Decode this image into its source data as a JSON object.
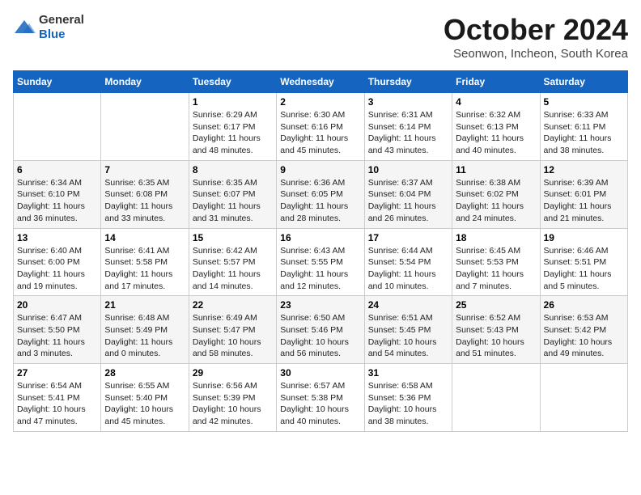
{
  "header": {
    "logo_general": "General",
    "logo_blue": "Blue",
    "month": "October 2024",
    "location": "Seonwon, Incheon, South Korea"
  },
  "days_of_week": [
    "Sunday",
    "Monday",
    "Tuesday",
    "Wednesday",
    "Thursday",
    "Friday",
    "Saturday"
  ],
  "weeks": [
    [
      {
        "num": "",
        "sunrise": "",
        "sunset": "",
        "daylight": ""
      },
      {
        "num": "",
        "sunrise": "",
        "sunset": "",
        "daylight": ""
      },
      {
        "num": "1",
        "sunrise": "Sunrise: 6:29 AM",
        "sunset": "Sunset: 6:17 PM",
        "daylight": "Daylight: 11 hours and 48 minutes."
      },
      {
        "num": "2",
        "sunrise": "Sunrise: 6:30 AM",
        "sunset": "Sunset: 6:16 PM",
        "daylight": "Daylight: 11 hours and 45 minutes."
      },
      {
        "num": "3",
        "sunrise": "Sunrise: 6:31 AM",
        "sunset": "Sunset: 6:14 PM",
        "daylight": "Daylight: 11 hours and 43 minutes."
      },
      {
        "num": "4",
        "sunrise": "Sunrise: 6:32 AM",
        "sunset": "Sunset: 6:13 PM",
        "daylight": "Daylight: 11 hours and 40 minutes."
      },
      {
        "num": "5",
        "sunrise": "Sunrise: 6:33 AM",
        "sunset": "Sunset: 6:11 PM",
        "daylight": "Daylight: 11 hours and 38 minutes."
      }
    ],
    [
      {
        "num": "6",
        "sunrise": "Sunrise: 6:34 AM",
        "sunset": "Sunset: 6:10 PM",
        "daylight": "Daylight: 11 hours and 36 minutes."
      },
      {
        "num": "7",
        "sunrise": "Sunrise: 6:35 AM",
        "sunset": "Sunset: 6:08 PM",
        "daylight": "Daylight: 11 hours and 33 minutes."
      },
      {
        "num": "8",
        "sunrise": "Sunrise: 6:35 AM",
        "sunset": "Sunset: 6:07 PM",
        "daylight": "Daylight: 11 hours and 31 minutes."
      },
      {
        "num": "9",
        "sunrise": "Sunrise: 6:36 AM",
        "sunset": "Sunset: 6:05 PM",
        "daylight": "Daylight: 11 hours and 28 minutes."
      },
      {
        "num": "10",
        "sunrise": "Sunrise: 6:37 AM",
        "sunset": "Sunset: 6:04 PM",
        "daylight": "Daylight: 11 hours and 26 minutes."
      },
      {
        "num": "11",
        "sunrise": "Sunrise: 6:38 AM",
        "sunset": "Sunset: 6:02 PM",
        "daylight": "Daylight: 11 hours and 24 minutes."
      },
      {
        "num": "12",
        "sunrise": "Sunrise: 6:39 AM",
        "sunset": "Sunset: 6:01 PM",
        "daylight": "Daylight: 11 hours and 21 minutes."
      }
    ],
    [
      {
        "num": "13",
        "sunrise": "Sunrise: 6:40 AM",
        "sunset": "Sunset: 6:00 PM",
        "daylight": "Daylight: 11 hours and 19 minutes."
      },
      {
        "num": "14",
        "sunrise": "Sunrise: 6:41 AM",
        "sunset": "Sunset: 5:58 PM",
        "daylight": "Daylight: 11 hours and 17 minutes."
      },
      {
        "num": "15",
        "sunrise": "Sunrise: 6:42 AM",
        "sunset": "Sunset: 5:57 PM",
        "daylight": "Daylight: 11 hours and 14 minutes."
      },
      {
        "num": "16",
        "sunrise": "Sunrise: 6:43 AM",
        "sunset": "Sunset: 5:55 PM",
        "daylight": "Daylight: 11 hours and 12 minutes."
      },
      {
        "num": "17",
        "sunrise": "Sunrise: 6:44 AM",
        "sunset": "Sunset: 5:54 PM",
        "daylight": "Daylight: 11 hours and 10 minutes."
      },
      {
        "num": "18",
        "sunrise": "Sunrise: 6:45 AM",
        "sunset": "Sunset: 5:53 PM",
        "daylight": "Daylight: 11 hours and 7 minutes."
      },
      {
        "num": "19",
        "sunrise": "Sunrise: 6:46 AM",
        "sunset": "Sunset: 5:51 PM",
        "daylight": "Daylight: 11 hours and 5 minutes."
      }
    ],
    [
      {
        "num": "20",
        "sunrise": "Sunrise: 6:47 AM",
        "sunset": "Sunset: 5:50 PM",
        "daylight": "Daylight: 11 hours and 3 minutes."
      },
      {
        "num": "21",
        "sunrise": "Sunrise: 6:48 AM",
        "sunset": "Sunset: 5:49 PM",
        "daylight": "Daylight: 11 hours and 0 minutes."
      },
      {
        "num": "22",
        "sunrise": "Sunrise: 6:49 AM",
        "sunset": "Sunset: 5:47 PM",
        "daylight": "Daylight: 10 hours and 58 minutes."
      },
      {
        "num": "23",
        "sunrise": "Sunrise: 6:50 AM",
        "sunset": "Sunset: 5:46 PM",
        "daylight": "Daylight: 10 hours and 56 minutes."
      },
      {
        "num": "24",
        "sunrise": "Sunrise: 6:51 AM",
        "sunset": "Sunset: 5:45 PM",
        "daylight": "Daylight: 10 hours and 54 minutes."
      },
      {
        "num": "25",
        "sunrise": "Sunrise: 6:52 AM",
        "sunset": "Sunset: 5:43 PM",
        "daylight": "Daylight: 10 hours and 51 minutes."
      },
      {
        "num": "26",
        "sunrise": "Sunrise: 6:53 AM",
        "sunset": "Sunset: 5:42 PM",
        "daylight": "Daylight: 10 hours and 49 minutes."
      }
    ],
    [
      {
        "num": "27",
        "sunrise": "Sunrise: 6:54 AM",
        "sunset": "Sunset: 5:41 PM",
        "daylight": "Daylight: 10 hours and 47 minutes."
      },
      {
        "num": "28",
        "sunrise": "Sunrise: 6:55 AM",
        "sunset": "Sunset: 5:40 PM",
        "daylight": "Daylight: 10 hours and 45 minutes."
      },
      {
        "num": "29",
        "sunrise": "Sunrise: 6:56 AM",
        "sunset": "Sunset: 5:39 PM",
        "daylight": "Daylight: 10 hours and 42 minutes."
      },
      {
        "num": "30",
        "sunrise": "Sunrise: 6:57 AM",
        "sunset": "Sunset: 5:38 PM",
        "daylight": "Daylight: 10 hours and 40 minutes."
      },
      {
        "num": "31",
        "sunrise": "Sunrise: 6:58 AM",
        "sunset": "Sunset: 5:36 PM",
        "daylight": "Daylight: 10 hours and 38 minutes."
      },
      {
        "num": "",
        "sunrise": "",
        "sunset": "",
        "daylight": ""
      },
      {
        "num": "",
        "sunrise": "",
        "sunset": "",
        "daylight": ""
      }
    ]
  ]
}
